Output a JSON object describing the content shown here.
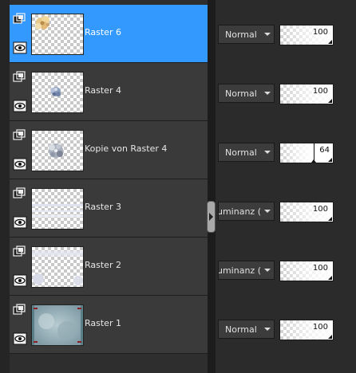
{
  "layers": [
    {
      "name": "Raster 6",
      "selected": true,
      "blend_mode": "Normal",
      "opacity": 100,
      "thumb": "flower-yellow"
    },
    {
      "name": "Raster 4",
      "selected": false,
      "blend_mode": "Normal",
      "opacity": 100,
      "thumb": "flower-small-blue"
    },
    {
      "name": "Kopie von Raster 4",
      "selected": false,
      "blend_mode": "Normal",
      "opacity": 64,
      "thumb": "flower-gray"
    },
    {
      "name": "Raster 3",
      "selected": false,
      "blend_mode": "uminanz (\\",
      "opacity": 100,
      "thumb": "faint-lines"
    },
    {
      "name": "Raster 2",
      "selected": false,
      "blend_mode": "uminanz (\\",
      "opacity": 100,
      "thumb": "faint-lavender"
    },
    {
      "name": "Raster 1",
      "selected": false,
      "blend_mode": "Normal",
      "opacity": 100,
      "thumb": "blue-texture"
    }
  ],
  "icons": {
    "layer_type": "raster-layer-icon",
    "visibility": "eye-icon",
    "splitter": "collapse-arrow-icon"
  },
  "colors": {
    "selection": "#3399ff",
    "row_bg": "#3a3a3a",
    "panel_bg": "#2b2b2b"
  }
}
